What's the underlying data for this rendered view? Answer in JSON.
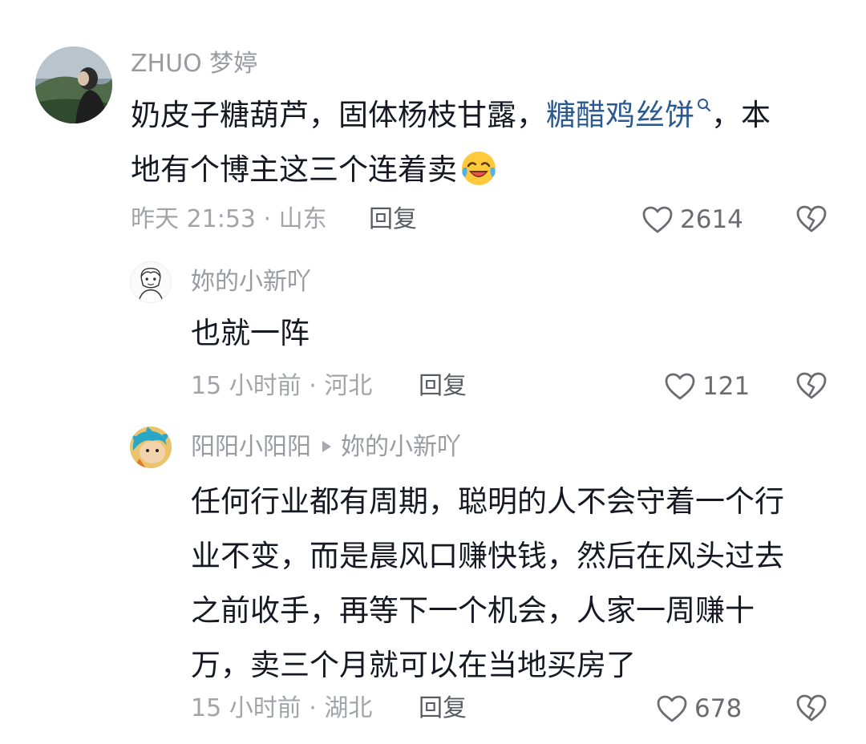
{
  "comments": [
    {
      "username": "ZHUO 梦婷",
      "text_before": "奶皮子糖葫芦，固体杨枝甘露，",
      "link_text": "糖醋鸡丝饼",
      "text_after_line1": "，本",
      "text_line2": "地有个博主这三个连着卖",
      "meta": "昨天 21:53 · 山东",
      "reply_label": "回复",
      "likes": "2614"
    },
    {
      "username": "妳的小新吖",
      "text": "也就一阵",
      "meta": "15 小时前 · 河北",
      "reply_label": "回复",
      "likes": "121"
    },
    {
      "username": "阳阳小阳阳",
      "reply_to": "妳的小新吖",
      "lines": [
        "任何行业都有周期，聪明的人不会守着一个行",
        "业不变，而是晨风口赚快钱，然后在风头过去",
        "之前收手，再等下一个机会，人家一周赚十",
        "万，卖三个月就可以在当地买房了"
      ],
      "meta": "15 小时前 · 湖北",
      "reply_label": "回复",
      "likes": "678"
    }
  ],
  "icons": {
    "like": "heart-outline-icon",
    "dislike": "broken-heart-icon",
    "search": "search-icon",
    "emoji": "laughing-crying-emoji"
  },
  "colors": {
    "link": "#2a5a8f",
    "text": "#161823",
    "meta": "#a3a4a9"
  }
}
